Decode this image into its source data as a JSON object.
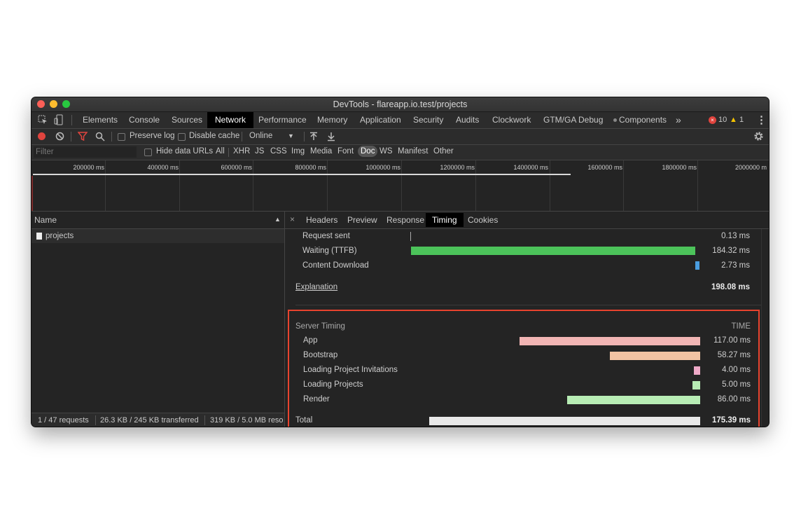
{
  "window": {
    "title": "DevTools - flareapp.io.test/projects",
    "traffic_lights": {
      "close": "#fd5f57",
      "minimize": "#febc2e",
      "zoom": "#28c840"
    }
  },
  "tabs": [
    {
      "label": "Elements"
    },
    {
      "label": "Console"
    },
    {
      "label": "Sources"
    },
    {
      "label": "Network",
      "active": true
    },
    {
      "label": "Performance"
    },
    {
      "label": "Memory"
    },
    {
      "label": "Application"
    },
    {
      "label": "Security"
    },
    {
      "label": "Audits"
    },
    {
      "label": "Clockwork"
    },
    {
      "label": "GTM/GA Debug"
    },
    {
      "label": "Components"
    }
  ],
  "badges": {
    "errors": "10",
    "warnings": "1"
  },
  "toolbar": {
    "preserve_log": "Preserve log",
    "disable_cache": "Disable cache",
    "throttle": "Online"
  },
  "filterbar": {
    "filter_placeholder": "Filter",
    "hide_data_urls": "Hide data URLs",
    "types": [
      "All",
      "XHR",
      "JS",
      "CSS",
      "Img",
      "Media",
      "Font",
      "Doc",
      "WS",
      "Manifest",
      "Other"
    ],
    "active_type": "Doc"
  },
  "overview": {
    "ticks": [
      "200000 ms",
      "400000 ms",
      "600000 ms",
      "800000 ms",
      "1000000 ms",
      "1200000 ms",
      "1400000 ms",
      "1600000 ms",
      "1800000 ms",
      "2000000 m"
    ]
  },
  "request_list": {
    "header": "Name",
    "rows": [
      {
        "name": "projects"
      }
    ]
  },
  "status": {
    "requests": "1 / 47 requests",
    "transferred": "26.3 KB / 245 KB transferred",
    "resources": "319 KB / 5.0 MB reso"
  },
  "detail_tabs": [
    {
      "label": "Headers"
    },
    {
      "label": "Preview"
    },
    {
      "label": "Response"
    },
    {
      "label": "Timing",
      "active": true
    },
    {
      "label": "Cookies"
    }
  ],
  "timing": {
    "rows": [
      {
        "label": "Request sent",
        "value": "0.13 ms"
      },
      {
        "label": "Waiting (TTFB)",
        "value": "184.32 ms",
        "color": "#4cc35a"
      },
      {
        "label": "Content Download",
        "value": "2.73 ms",
        "color": "#4a9de0"
      }
    ],
    "explanation": "Explanation",
    "total": "198.08 ms"
  },
  "server_timing": {
    "heading": "Server Timing",
    "time_header": "TIME",
    "rows": [
      {
        "label": "App",
        "value": "117.00 ms",
        "ms": 117.0,
        "color": "#f1b5b4"
      },
      {
        "label": "Bootstrap",
        "value": "58.27 ms",
        "ms": 58.27,
        "color": "#f2c3a3"
      },
      {
        "label": "Loading Project Invitations",
        "value": "4.00 ms",
        "ms": 4.0,
        "color": "#eea9c7"
      },
      {
        "label": "Loading Projects",
        "value": "5.00 ms",
        "ms": 5.0,
        "color": "#b7ecb4"
      },
      {
        "label": "Render",
        "value": "86.00 ms",
        "ms": 86.0,
        "color": "#b7ecb4"
      }
    ],
    "total_label": "Total",
    "total_value": "175.39 ms",
    "total_ms": 175.39,
    "total_color": "#e8e8e8",
    "highlight_color": "#e8432e"
  }
}
